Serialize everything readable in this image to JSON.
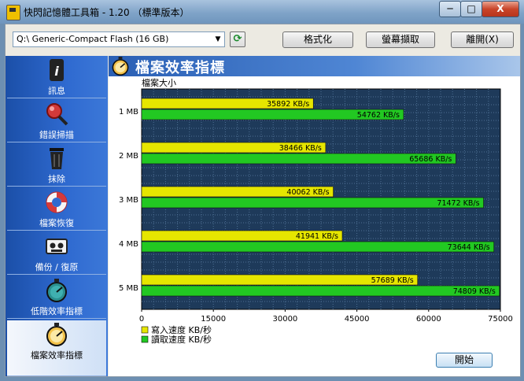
{
  "window": {
    "title": "快閃記憶體工具箱 - 1.20 （標準版本）",
    "min_label": "─",
    "max_label": "□",
    "close_label": "X"
  },
  "toolbar": {
    "drive": "Q:\\ Generic-Compact Flash (16 GB)",
    "format_label": "格式化",
    "capture_label": "螢幕擷取",
    "exit_label": "離開(X)"
  },
  "sidebar": {
    "items": [
      {
        "label": "訊息",
        "icon": "info-icon"
      },
      {
        "label": "錯誤掃描",
        "icon": "magnifier-icon"
      },
      {
        "label": "抹除",
        "icon": "trash-icon"
      },
      {
        "label": "檔案恢復",
        "icon": "lifebuoy-icon"
      },
      {
        "label": "備份 / 復原",
        "icon": "tape-icon"
      },
      {
        "label": "低階效率指標",
        "icon": "stopwatch-icon"
      },
      {
        "label": "檔案效率指標",
        "icon": "stopwatch-icon"
      }
    ],
    "active_index": 6
  },
  "section": {
    "title": "檔案效率指標",
    "icon": "stopwatch-icon"
  },
  "chart_data": {
    "type": "bar",
    "orientation": "horizontal",
    "ylabel": "檔案大小",
    "categories": [
      "1 MB",
      "2 MB",
      "3 MB",
      "4 MB",
      "5 MB"
    ],
    "series": [
      {
        "name": "寫入速度 KB/秒",
        "color": "#e6e600",
        "values": [
          35892,
          38466,
          40062,
          41941,
          57689
        ],
        "labels": [
          "35892 KB/s",
          "38466 KB/s",
          "40062 KB/s",
          "41941 KB/s",
          "57689 KB/s"
        ]
      },
      {
        "name": "讀取速度 KB/秒",
        "color": "#22c822",
        "values": [
          54762,
          65686,
          71472,
          73644,
          74809
        ],
        "labels": [
          "54762 KB/s",
          "65686 KB/s",
          "71472 KB/s",
          "73644 KB/s",
          "74809 KB/s"
        ]
      }
    ],
    "xlim": [
      0,
      75000
    ],
    "xticks": [
      "0",
      "15000",
      "30000",
      "45000",
      "60000",
      "75000"
    ],
    "grid": true,
    "legend_position": "bottom-left",
    "plot_background": "#1e3a5a"
  },
  "actions": {
    "start_label": "開始"
  }
}
